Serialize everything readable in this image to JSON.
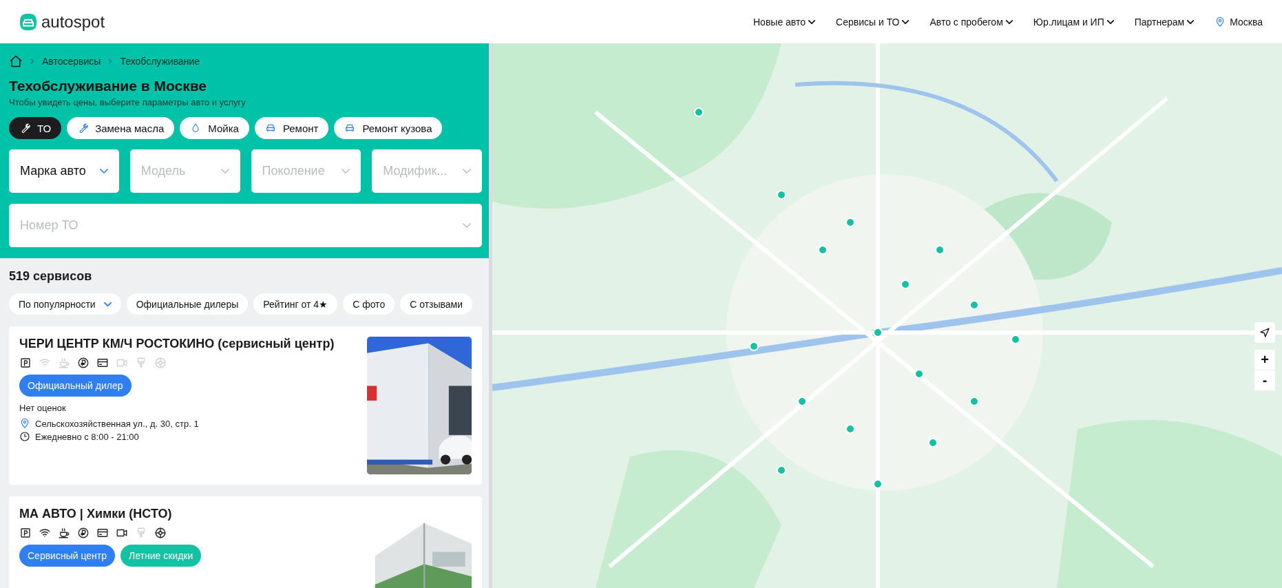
{
  "header": {
    "logo": "autospot",
    "nav": [
      {
        "label": "Новые авто"
      },
      {
        "label": "Сервисы и ТО"
      },
      {
        "label": "Авто с пробегом"
      },
      {
        "label": "Юр.лицам и ИП"
      },
      {
        "label": "Партнерам"
      }
    ],
    "city": "Москва"
  },
  "breadcrumbs": [
    "Автосервисы",
    "Техобслуживание"
  ],
  "title": "Техобслуживание в Москве",
  "subtitle": "Чтобы увидеть цены, выберите параметры авто и услугу",
  "service_tabs": [
    {
      "label": "ТО",
      "kind": "wrench",
      "selected": true
    },
    {
      "label": "Замена масла",
      "kind": "wrench",
      "selected": false
    },
    {
      "label": "Мойка",
      "kind": "drop",
      "selected": false
    },
    {
      "label": "Ремонт",
      "kind": "car",
      "selected": false
    },
    {
      "label": "Ремонт кузова",
      "kind": "car",
      "selected": false
    }
  ],
  "selects": [
    {
      "value": "Марка авто",
      "disabled": false
    },
    {
      "placeholder": "Модель",
      "disabled": true
    },
    {
      "placeholder": "Поколение",
      "disabled": true
    },
    {
      "placeholder": "Модифик...",
      "disabled": true
    }
  ],
  "maintenance_select": {
    "placeholder": "Номер ТО"
  },
  "count": "519 сервисов",
  "filters": [
    {
      "label": "По популярности",
      "kind": "sort"
    },
    {
      "label": "Официальные дилеры",
      "kind": "toggle"
    },
    {
      "label": "Рейтинг от 4★",
      "kind": "toggle"
    },
    {
      "label": "С фото",
      "kind": "toggle"
    },
    {
      "label": "С отзывами",
      "kind": "toggle"
    }
  ],
  "services": [
    {
      "name": "ЧЕРИ ЦЕНТР КМ/Ч РОСТОКИНО (сервисный центр)",
      "amenities": [
        {
          "kind": "parking",
          "available": true
        },
        {
          "kind": "wifi",
          "available": false
        },
        {
          "kind": "coffee",
          "available": false
        },
        {
          "kind": "ruble",
          "available": true
        },
        {
          "kind": "card",
          "available": true
        },
        {
          "kind": "camera",
          "available": false
        },
        {
          "kind": "brush",
          "available": false
        },
        {
          "kind": "wheel",
          "available": false
        }
      ],
      "badges": [
        {
          "label": "Официальный дилер",
          "color": "#2f7ff0"
        }
      ],
      "rating": "Нет оценок",
      "address": "Сельскохозяйственная ул., д. 30, стр. 1",
      "hours": "Ежедневно с 8:00 - 21:00",
      "photo": {
        "kind": "picture"
      }
    },
    {
      "name": "МА АВТО | Химки (НСТО)",
      "amenities": [
        {
          "kind": "parking",
          "available": true
        },
        {
          "kind": "wifi",
          "available": true
        },
        {
          "kind": "coffee",
          "available": true
        },
        {
          "kind": "ruble",
          "available": true
        },
        {
          "kind": "card",
          "available": true
        },
        {
          "kind": "camera",
          "available": true
        },
        {
          "kind": "brush",
          "available": false
        },
        {
          "kind": "wheel",
          "available": true
        }
      ],
      "badges": [
        {
          "label": "Сервисный центр",
          "color": "#2f7ff0"
        },
        {
          "label": "Летние скидки",
          "color": "#14c2a3"
        }
      ],
      "photo": {
        "kind": "picture"
      }
    }
  ],
  "map": {
    "kind": "picture",
    "controls": [
      {
        "kind": "locate"
      },
      {
        "kind": "zoom",
        "label": "+"
      },
      {
        "kind": "zoom",
        "label": "-"
      }
    ]
  }
}
